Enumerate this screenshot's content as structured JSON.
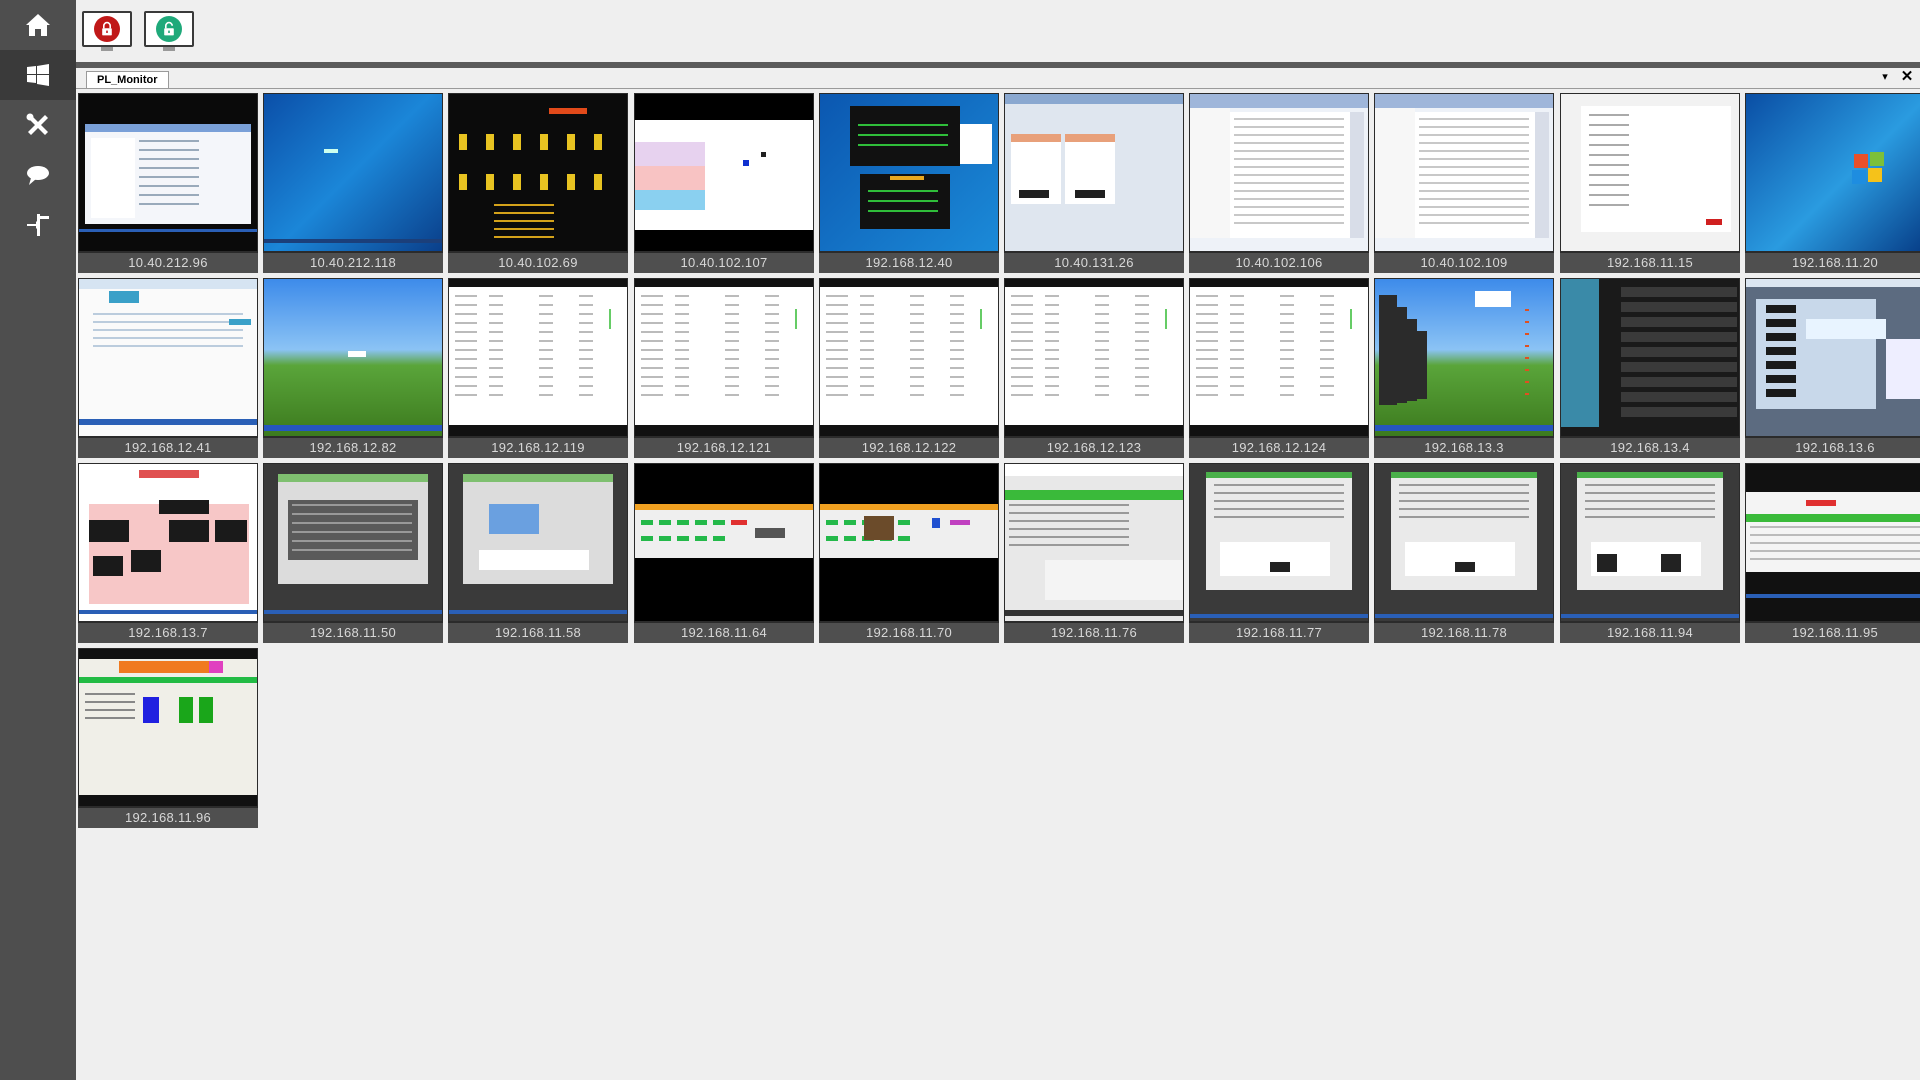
{
  "sidebar": {
    "items": [
      {
        "name": "home-icon"
      },
      {
        "name": "windows-icon",
        "active": true
      },
      {
        "name": "tools-icon"
      },
      {
        "name": "chat-icon"
      },
      {
        "name": "network-icon"
      }
    ]
  },
  "toolbar": {
    "buttons": [
      {
        "name": "lock-all-button",
        "icon": "lock-closed-icon",
        "color": "#c01818"
      },
      {
        "name": "unlock-all-button",
        "icon": "lock-open-icon",
        "color": "#1fa97a"
      }
    ]
  },
  "tab": {
    "label": "PL_Monitor",
    "menu_glyph": "▾",
    "close_glyph": "✕"
  },
  "monitors": [
    {
      "ip": "10.40.212.96",
      "style": "desktop-window"
    },
    {
      "ip": "10.40.212.118",
      "style": "win7-blue"
    },
    {
      "ip": "10.40.102.69",
      "style": "dark-gauges"
    },
    {
      "ip": "10.40.102.107",
      "style": "spreadsheet-color"
    },
    {
      "ip": "192.168.12.40",
      "style": "dark-dashboard"
    },
    {
      "ip": "10.40.131.26",
      "style": "report-panels"
    },
    {
      "ip": "10.40.102.106",
      "style": "excel"
    },
    {
      "ip": "10.40.102.109",
      "style": "excel"
    },
    {
      "ip": "192.168.11.15",
      "style": "white-doc"
    },
    {
      "ip": "192.168.11.20",
      "style": "win7-logo"
    },
    {
      "ip": "192.168.12.41",
      "style": "web-app"
    },
    {
      "ip": "192.168.12.82",
      "style": "xp-bliss"
    },
    {
      "ip": "192.168.12.119",
      "style": "white-table"
    },
    {
      "ip": "192.168.12.121",
      "style": "white-table"
    },
    {
      "ip": "192.168.12.122",
      "style": "white-table"
    },
    {
      "ip": "192.168.12.123",
      "style": "white-table"
    },
    {
      "ip": "192.168.12.124",
      "style": "white-table"
    },
    {
      "ip": "192.168.13.3",
      "style": "xp-bliss-windows"
    },
    {
      "ip": "192.168.13.4",
      "style": "dark-rows"
    },
    {
      "ip": "192.168.13.6",
      "style": "multi-window"
    },
    {
      "ip": "192.168.13.7",
      "style": "pink-diagram"
    },
    {
      "ip": "192.168.11.50",
      "style": "gray-app"
    },
    {
      "ip": "192.168.11.58",
      "style": "gray-app-2"
    },
    {
      "ip": "192.168.11.64",
      "style": "black-green-strip"
    },
    {
      "ip": "192.168.11.70",
      "style": "black-green-strip-2"
    },
    {
      "ip": "192.168.11.76",
      "style": "green-table"
    },
    {
      "ip": "192.168.11.77",
      "style": "gray-chart"
    },
    {
      "ip": "192.168.11.78",
      "style": "gray-chart"
    },
    {
      "ip": "192.168.11.94",
      "style": "gray-chart-2"
    },
    {
      "ip": "192.168.11.95",
      "style": "green-grid"
    },
    {
      "ip": "192.168.11.96",
      "style": "orange-header"
    }
  ]
}
